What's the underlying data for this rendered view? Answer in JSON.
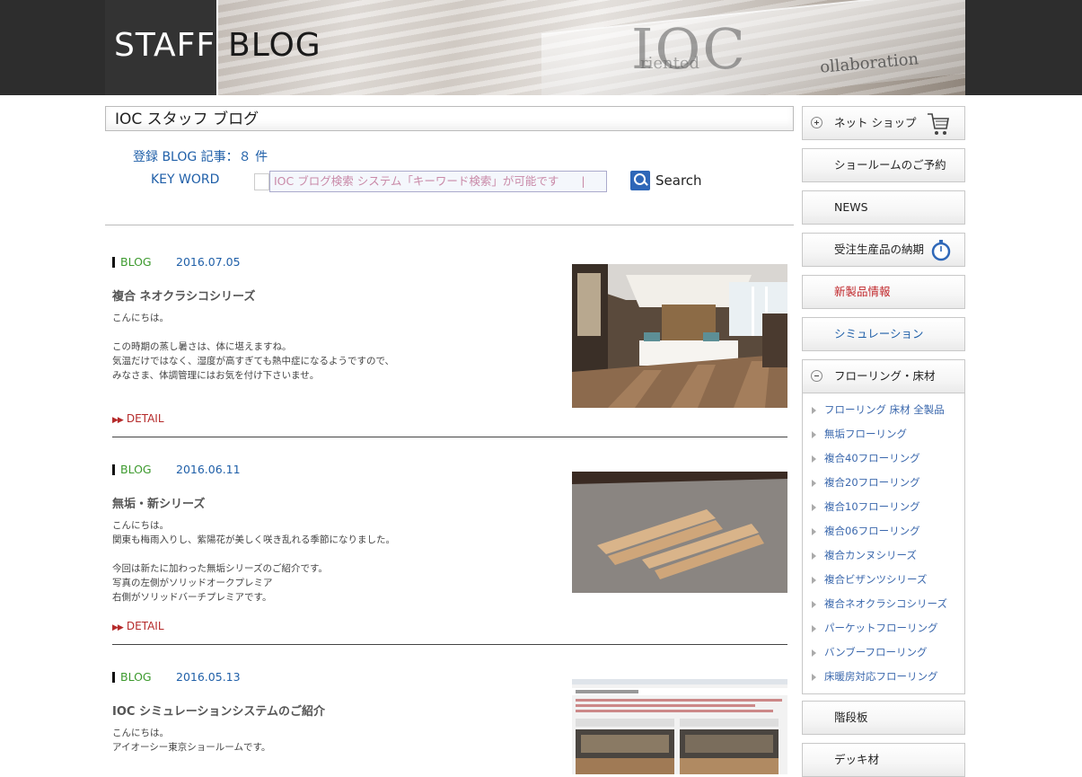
{
  "header": {
    "title_left": "STAFF",
    "title_right": "BLOG",
    "banner_text_1": "IOC",
    "banner_text_2": "riented",
    "banner_text_3": "ollaboration"
  },
  "page_title": "IOC スタッフ ブログ",
  "search": {
    "count_text": "登録 BLOG 記事：８ 件",
    "keyword_label": "KEY WORD",
    "value": "IOC ブログ検索 システム「キーワード検索」が可能です　　|",
    "button_label": "Search"
  },
  "posts": [
    {
      "category": "BLOG",
      "date": "2016.07.05",
      "title": "複合 ネオクラシコシリーズ",
      "body": [
        "こんにちは。",
        "",
        "この時期の蒸し暑さは、体に堪えますね。",
        "気温だけではなく、湿度が高すぎても熱中症になるようですので、",
        "みなさま、体調管理にはお気を付け下さいませ。"
      ],
      "detail": "DETAIL",
      "detail_arrow": "▶▶"
    },
    {
      "category": "BLOG",
      "date": "2016.06.11",
      "title": "無垢・新シリーズ",
      "body": [
        "こんにちは。",
        "関東も梅雨入りし、紫陽花が美しく咲き乱れる季節になりました。",
        "",
        "今回は新たに加わった無垢シリーズのご紹介です。",
        "写真の左側がソリッドオークプレミア",
        "右側がソリッドバーチプレミアです。"
      ],
      "detail": "DETAIL",
      "detail_arrow": "▶▶"
    },
    {
      "category": "BLOG",
      "date": "2016.05.13",
      "title": "IOC シミュレーションシステムのご紹介",
      "body": [
        "こんにちは。",
        "アイオーシー東京ショールームです。"
      ],
      "detail": "",
      "detail_arrow": ""
    }
  ],
  "sidebar": {
    "buttons": [
      {
        "label": "ネット ショップ",
        "icon": "cart-icon"
      },
      {
        "label": "ショールームのご予約"
      },
      {
        "label": "NEWS"
      },
      {
        "label": "受注生産品の納期",
        "icon": "stopwatch-icon"
      },
      {
        "label": "新製品情報",
        "color": "#c0262a"
      },
      {
        "label": "シミュレーション",
        "color": "#1f5fa8"
      },
      {
        "label": "フローリング・床材"
      },
      {
        "label": "階段板"
      },
      {
        "label": "デッキ材"
      }
    ],
    "flooring_items": [
      "フローリング 床材 全製品",
      "無垢フローリング",
      "複合40フローリング",
      "複合20フローリング",
      "複合10フローリング",
      "複合06フローリング",
      "複合カンヌシリーズ",
      "複合ビザンツシリーズ",
      "複合ネオクラシコシリーズ",
      "パーケットフローリング",
      "バンブーフローリング",
      "床暖房対応フローリング"
    ]
  },
  "colors": {
    "accent_blue": "#1f5fa8",
    "category_green": "#3d9a2e",
    "detail_red": "#b52a2a",
    "header_dark": "#2d2d2d"
  }
}
